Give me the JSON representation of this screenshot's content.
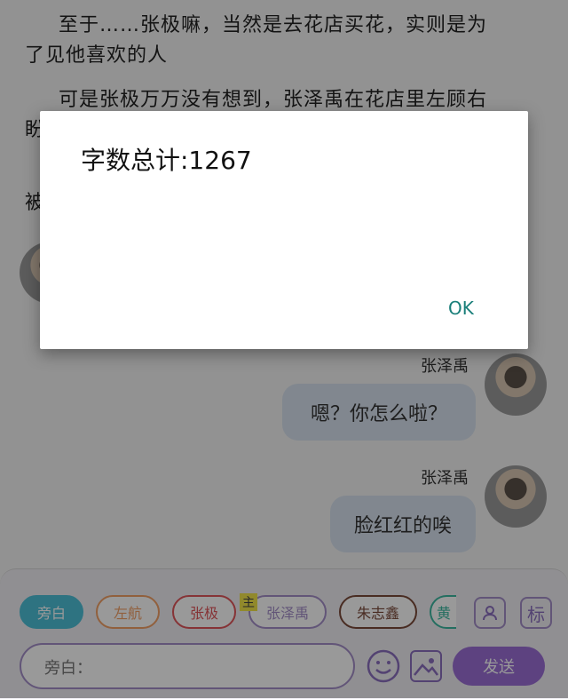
{
  "story": {
    "line1": "至于……张极嘛，当然是去花店买花，实则是为",
    "line2": "了见他喜欢的人",
    "line3": "可是张极万万没有想到，张泽禹在花店里左顾右",
    "line4_fragment": "盼",
    "line5_fragment": "被"
  },
  "messages": [
    {
      "name": "张泽禹",
      "text": "嗯？你怎么啦？"
    },
    {
      "name": "张泽禹",
      "text": "脸红红的唉"
    }
  ],
  "toolbar": {
    "chips": [
      {
        "label": "旁白",
        "color": "#4ec0d8",
        "selected": true
      },
      {
        "label": "左航",
        "color": "#f2a066"
      },
      {
        "label": "张极",
        "color": "#e0555a"
      },
      {
        "label": "张泽禹",
        "color": "#a48ec8",
        "badge": "主"
      },
      {
        "label": "朱志鑫",
        "color": "#7a4a3a"
      },
      {
        "label": "黄",
        "color": "#3cb8a0"
      }
    ],
    "user_icon": "user-icon",
    "label_icon_text": "标",
    "input_placeholder": "旁白：",
    "emoji_icon": "emoji-icon",
    "image_icon": "image-icon",
    "send_label": "发送",
    "send_color": "#9b6fd6"
  },
  "dialog": {
    "title": "字数总计:1267",
    "ok_label": "OK"
  }
}
